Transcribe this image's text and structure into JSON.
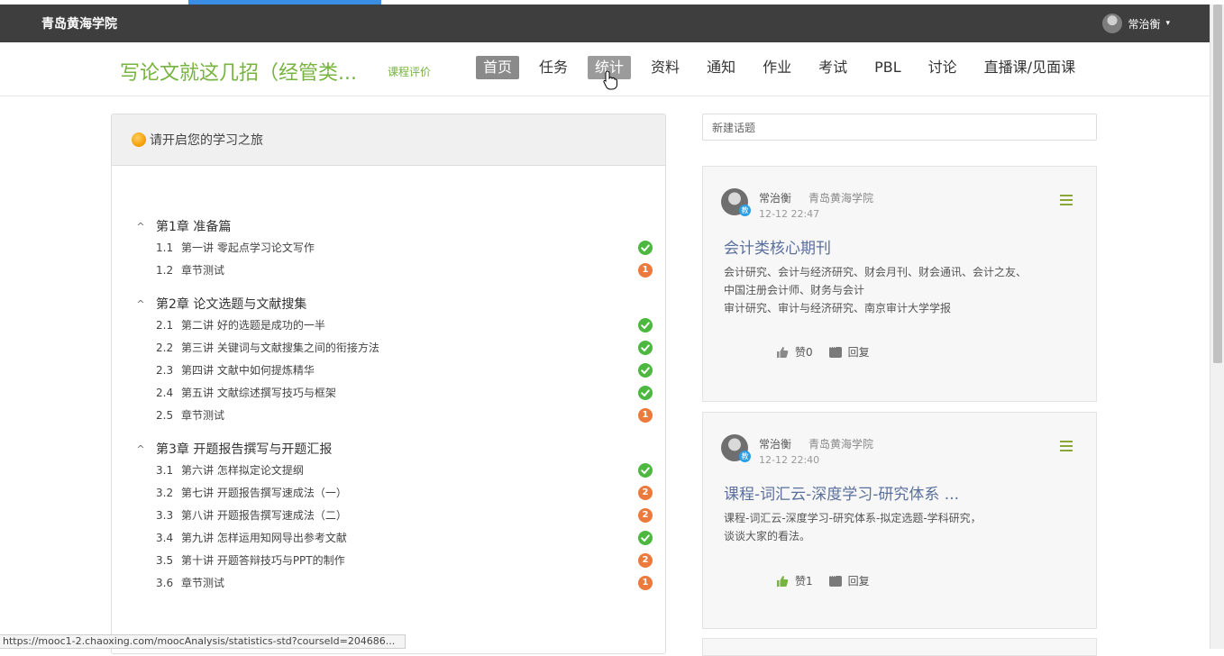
{
  "header": {
    "school": "青岛黄海学院",
    "user_name": "常治衡"
  },
  "nav": {
    "course_title": "写论文就这几招（经管类...",
    "course_eval": "课程评价",
    "tabs": [
      "首页",
      "任务",
      "统计",
      "资料",
      "通知",
      "作业",
      "考试",
      "PBL",
      "讨论",
      "直播课/见面课"
    ],
    "active_tab": "首页",
    "hover_tab": "统计"
  },
  "left_panel": {
    "heading": "请开启您的学习之旅",
    "chapters": [
      {
        "title": "第1章 准备篇",
        "items": [
          {
            "num": "1.1",
            "title": "第一讲 零起点学习论文写作",
            "status": "done",
            "badge": ""
          },
          {
            "num": "1.2",
            "title": "章节测试",
            "status": "todo",
            "badge": "1"
          }
        ]
      },
      {
        "title": "第2章 论文选题与文献搜集",
        "items": [
          {
            "num": "2.1",
            "title": "第二讲 好的选题是成功的一半",
            "status": "done",
            "badge": ""
          },
          {
            "num": "2.2",
            "title": "第三讲 关键词与文献搜集之间的衔接方法",
            "status": "done",
            "badge": ""
          },
          {
            "num": "2.3",
            "title": "第四讲 文献中如何提炼精华",
            "status": "done",
            "badge": ""
          },
          {
            "num": "2.4",
            "title": "第五讲 文献综述撰写技巧与框架",
            "status": "done",
            "badge": ""
          },
          {
            "num": "2.5",
            "title": "章节测试",
            "status": "todo",
            "badge": "1"
          }
        ]
      },
      {
        "title": "第3章 开题报告撰写与开题汇报",
        "items": [
          {
            "num": "3.1",
            "title": "第六讲 怎样拟定论文提纲",
            "status": "done",
            "badge": ""
          },
          {
            "num": "3.2",
            "title": "第七讲 开题报告撰写速成法（一）",
            "status": "todo",
            "badge": "2"
          },
          {
            "num": "3.3",
            "title": "第八讲 开题报告撰写速成法（二）",
            "status": "todo",
            "badge": "2"
          },
          {
            "num": "3.4",
            "title": "第九讲 怎样运用知网导出参考文献",
            "status": "done",
            "badge": ""
          },
          {
            "num": "3.5",
            "title": "第十讲 开题答辩技巧与PPT的制作",
            "status": "todo",
            "badge": "2"
          },
          {
            "num": "3.6",
            "title": "章节测试",
            "status": "todo",
            "badge": "1"
          }
        ]
      }
    ]
  },
  "right_col": {
    "new_topic_placeholder": "新建话题",
    "posts": [
      {
        "author": "常治衡",
        "org": "青岛黄海学院",
        "time": "12-12 22:47",
        "badge": "教",
        "title": "会计类核心期刊",
        "body_lines": [
          "会计研究、会计与经济研究、财会月刊、财会通讯、会计之友、",
          "中国注册会计师、财务与会计",
          "审计研究、审计与经济研究、南京审计大学学报"
        ],
        "like_label": "赞0",
        "reply_label": "回复",
        "liked": false
      },
      {
        "author": "常治衡",
        "org": "青岛黄海学院",
        "time": "12-12 22:40",
        "badge": "教",
        "title": "课程-词汇云-深度学习-研究体系 ...",
        "body_lines": [
          "课程-词汇云-深度学习-研究体系-拟定选题-学科研究，",
          "谈谈大家的看法。"
        ],
        "like_label": "赞1",
        "reply_label": "回复",
        "liked": true
      }
    ]
  },
  "status_url": "https://mooc1-2.chaoxing.com/moocAnalysis/statistics-std?courseId=204686...",
  "colors": {
    "accent_green": "#77b33f",
    "done": "#4cb83f",
    "todo": "#eb7a3c",
    "topbar": "#3e3e3e",
    "post_title": "#5a6f9c"
  },
  "icons": [
    "caret-down-icon",
    "orange-dot-icon",
    "check-icon",
    "thumb-up-icon",
    "reply-icon",
    "menu-icon",
    "mouse-pointer-icon"
  ]
}
